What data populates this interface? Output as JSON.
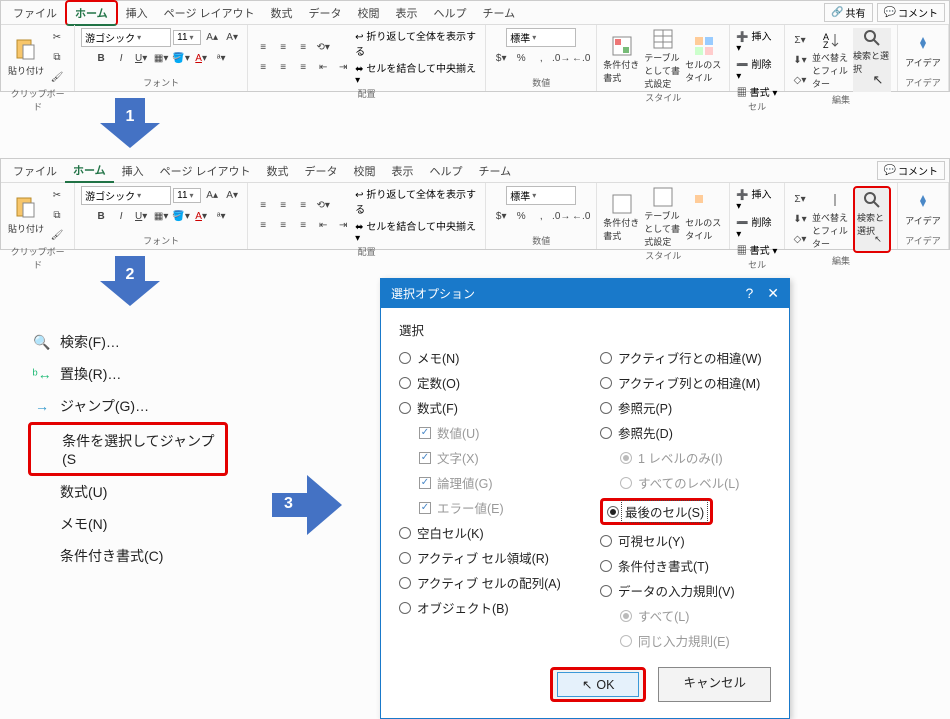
{
  "tabs": {
    "file": "ファイル",
    "home": "ホーム",
    "insert": "挿入",
    "pagelayout": "ページ レイアウト",
    "formulas": "数式",
    "data": "データ",
    "review": "校閲",
    "view": "表示",
    "help": "ヘルプ",
    "team": "チーム",
    "share": "共有",
    "comment": "コメント"
  },
  "groups": {
    "clipboard": "クリップボード",
    "font": "フォント",
    "alignment": "配置",
    "number": "数値",
    "styles": "スタイル",
    "cells": "セル",
    "editing": "編集",
    "ideas": "アイデア"
  },
  "font": {
    "name": "游ゴシック",
    "size": "11"
  },
  "number_format": "標準",
  "alignment": {
    "wrap": "折り返して全体を表示する",
    "merge": "セルを結合して中央揃え"
  },
  "big_buttons": {
    "paste": "貼り付け",
    "conditional": "条件付き書式",
    "table": "テーブルとして書式設定",
    "cellstyle": "セルのスタイル",
    "insert": "挿入",
    "delete": "削除",
    "format": "書式",
    "sort": "並べ替えとフィルター",
    "find": "検索と選択",
    "ideas": "アイデア"
  },
  "steps": {
    "s1": "1",
    "s2": "2",
    "s3": "3"
  },
  "menu": {
    "find": "検索(F)…",
    "replace": "置換(R)…",
    "goto": "ジャンプ(G)…",
    "gotospecial": "条件を選択してジャンプ(S",
    "formulas": "数式(U)",
    "notes": "メモ(N)",
    "condformat": "条件付き書式(C)"
  },
  "dialog": {
    "title": "選択オプション",
    "section": "選択",
    "left": {
      "notes": "メモ(N)",
      "constants": "定数(O)",
      "formulas": "数式(F)",
      "num": "数値(U)",
      "text": "文字(X)",
      "logic": "論理値(G)",
      "err": "エラー値(E)",
      "blanks": "空白セル(K)",
      "region": "アクティブ セル領域(R)",
      "array": "アクティブ セルの配列(A)",
      "objects": "オブジェクト(B)"
    },
    "right": {
      "rowdiff": "アクティブ行との相違(W)",
      "coldiff": "アクティブ列との相違(M)",
      "precedents": "参照元(P)",
      "dependents": "参照先(D)",
      "onelevel": "1 レベルのみ(I)",
      "alllevels": "すべてのレベル(L)",
      "lastcell": "最後のセル(S)",
      "visible": "可視セル(Y)",
      "condformat": "条件付き書式(T)",
      "validation": "データの入力規則(V)",
      "all": "すべて(L)",
      "same": "同じ入力規則(E)"
    },
    "ok": "OK",
    "cancel": "キャンセル"
  }
}
